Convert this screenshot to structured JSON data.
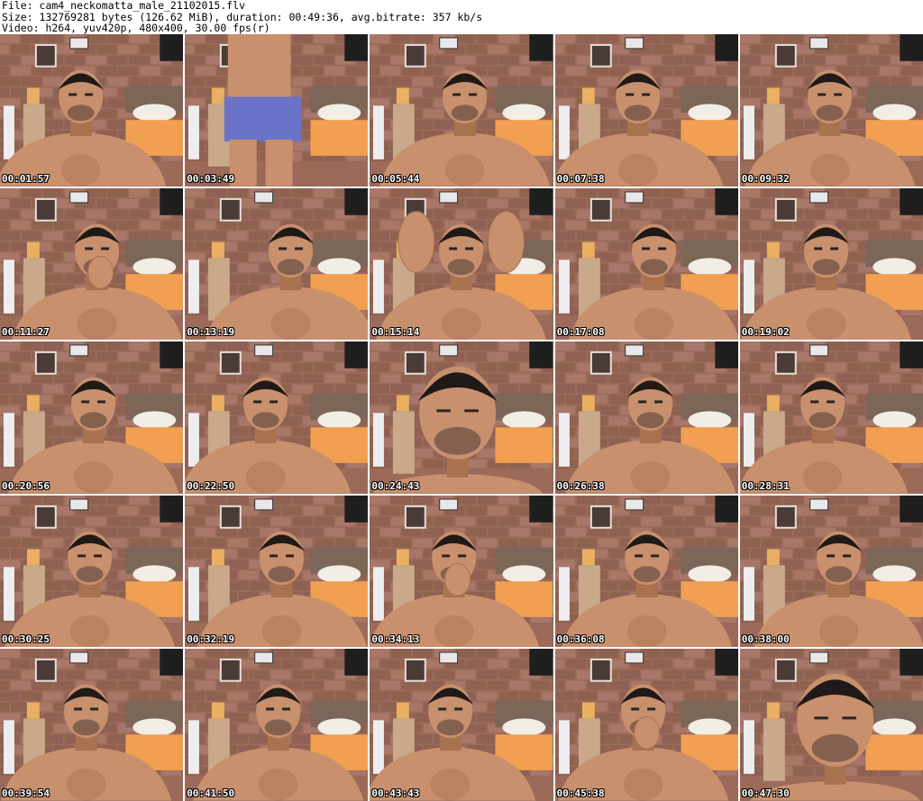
{
  "header": {
    "file": "File: cam4_neckomatta_male_21102015.flv",
    "size": "Size: 132769281 bytes (126.62 MiB), duration: 00:49:36, avg.bitrate: 357 kb/s",
    "video": "Video: h264, yuv420p, 480x400, 30.00 fps(r)"
  },
  "thumbnails": [
    {
      "timestamp": "00:01:57",
      "scene": "face"
    },
    {
      "timestamp": "00:03:49",
      "scene": "body-standing"
    },
    {
      "timestamp": "00:05:44",
      "scene": "face"
    },
    {
      "timestamp": "00:07:38",
      "scene": "face"
    },
    {
      "timestamp": "00:09:32",
      "scene": "face"
    },
    {
      "timestamp": "00:11:27",
      "scene": "face-hand"
    },
    {
      "timestamp": "00:13:19",
      "scene": "face-side"
    },
    {
      "timestamp": "00:15:14",
      "scene": "face-hands-raised"
    },
    {
      "timestamp": "00:17:08",
      "scene": "face"
    },
    {
      "timestamp": "00:19:02",
      "scene": "face"
    },
    {
      "timestamp": "00:20:56",
      "scene": "face"
    },
    {
      "timestamp": "00:22:50",
      "scene": "face"
    },
    {
      "timestamp": "00:24:43",
      "scene": "face-close"
    },
    {
      "timestamp": "00:26:38",
      "scene": "face"
    },
    {
      "timestamp": "00:28:31",
      "scene": "face"
    },
    {
      "timestamp": "00:30:25",
      "scene": "face"
    },
    {
      "timestamp": "00:32:19",
      "scene": "face"
    },
    {
      "timestamp": "00:34:13",
      "scene": "face-hand"
    },
    {
      "timestamp": "00:36:08",
      "scene": "face"
    },
    {
      "timestamp": "00:38:00",
      "scene": "face"
    },
    {
      "timestamp": "00:39:54",
      "scene": "face"
    },
    {
      "timestamp": "00:41:50",
      "scene": "face"
    },
    {
      "timestamp": "00:43:43",
      "scene": "face"
    },
    {
      "timestamp": "00:45:38",
      "scene": "face-hand"
    },
    {
      "timestamp": "00:47:30",
      "scene": "face-close"
    }
  ]
}
